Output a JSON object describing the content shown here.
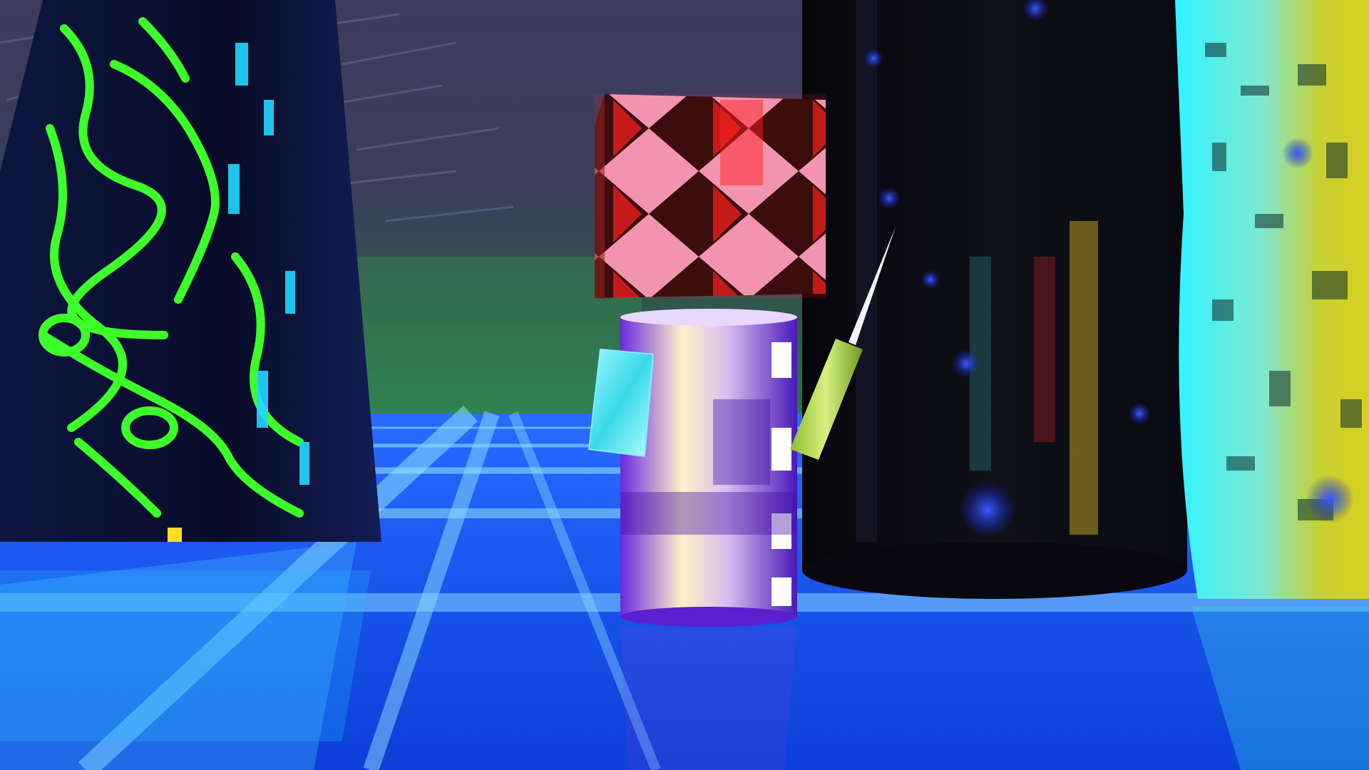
{
  "scene": {
    "type": "3d-rendered-game-world",
    "hud_text": [],
    "palette": {
      "sky_top": "#3a3a5c",
      "sky_horizon": "#2f6b45",
      "floor": "#0b4fe0",
      "floor_grid": "#7fd9ff",
      "left_pillar_base": "#0a0f2e",
      "left_pillar_veins": "#3dff2a",
      "right_pillar_cyan": "#2ef2ff",
      "right_pillar_yellow": "#d9d020",
      "cube_red": "#ff2a2a",
      "cube_pink": "#f0a0c0",
      "cylinder_purple": "#5a1fd0",
      "cylinder_cream": "#fff0c0",
      "orb_blue": "#1e3cff"
    },
    "objects": [
      {
        "name": "left-pillar",
        "pattern": "green-veins"
      },
      {
        "name": "character-head",
        "pattern": "triangle-checker"
      },
      {
        "name": "character-body",
        "pattern": "purple-cream-panels"
      },
      {
        "name": "left-arm",
        "pattern": "cyan-marble"
      },
      {
        "name": "right-arm",
        "pattern": "green-wood"
      },
      {
        "name": "needle",
        "pattern": "white-spike"
      },
      {
        "name": "dark-pillar",
        "pattern": "dark-cylinder"
      },
      {
        "name": "right-pillar",
        "pattern": "cyan-yellow-circuit"
      },
      {
        "name": "floating-orbs",
        "count": 9
      }
    ]
  }
}
